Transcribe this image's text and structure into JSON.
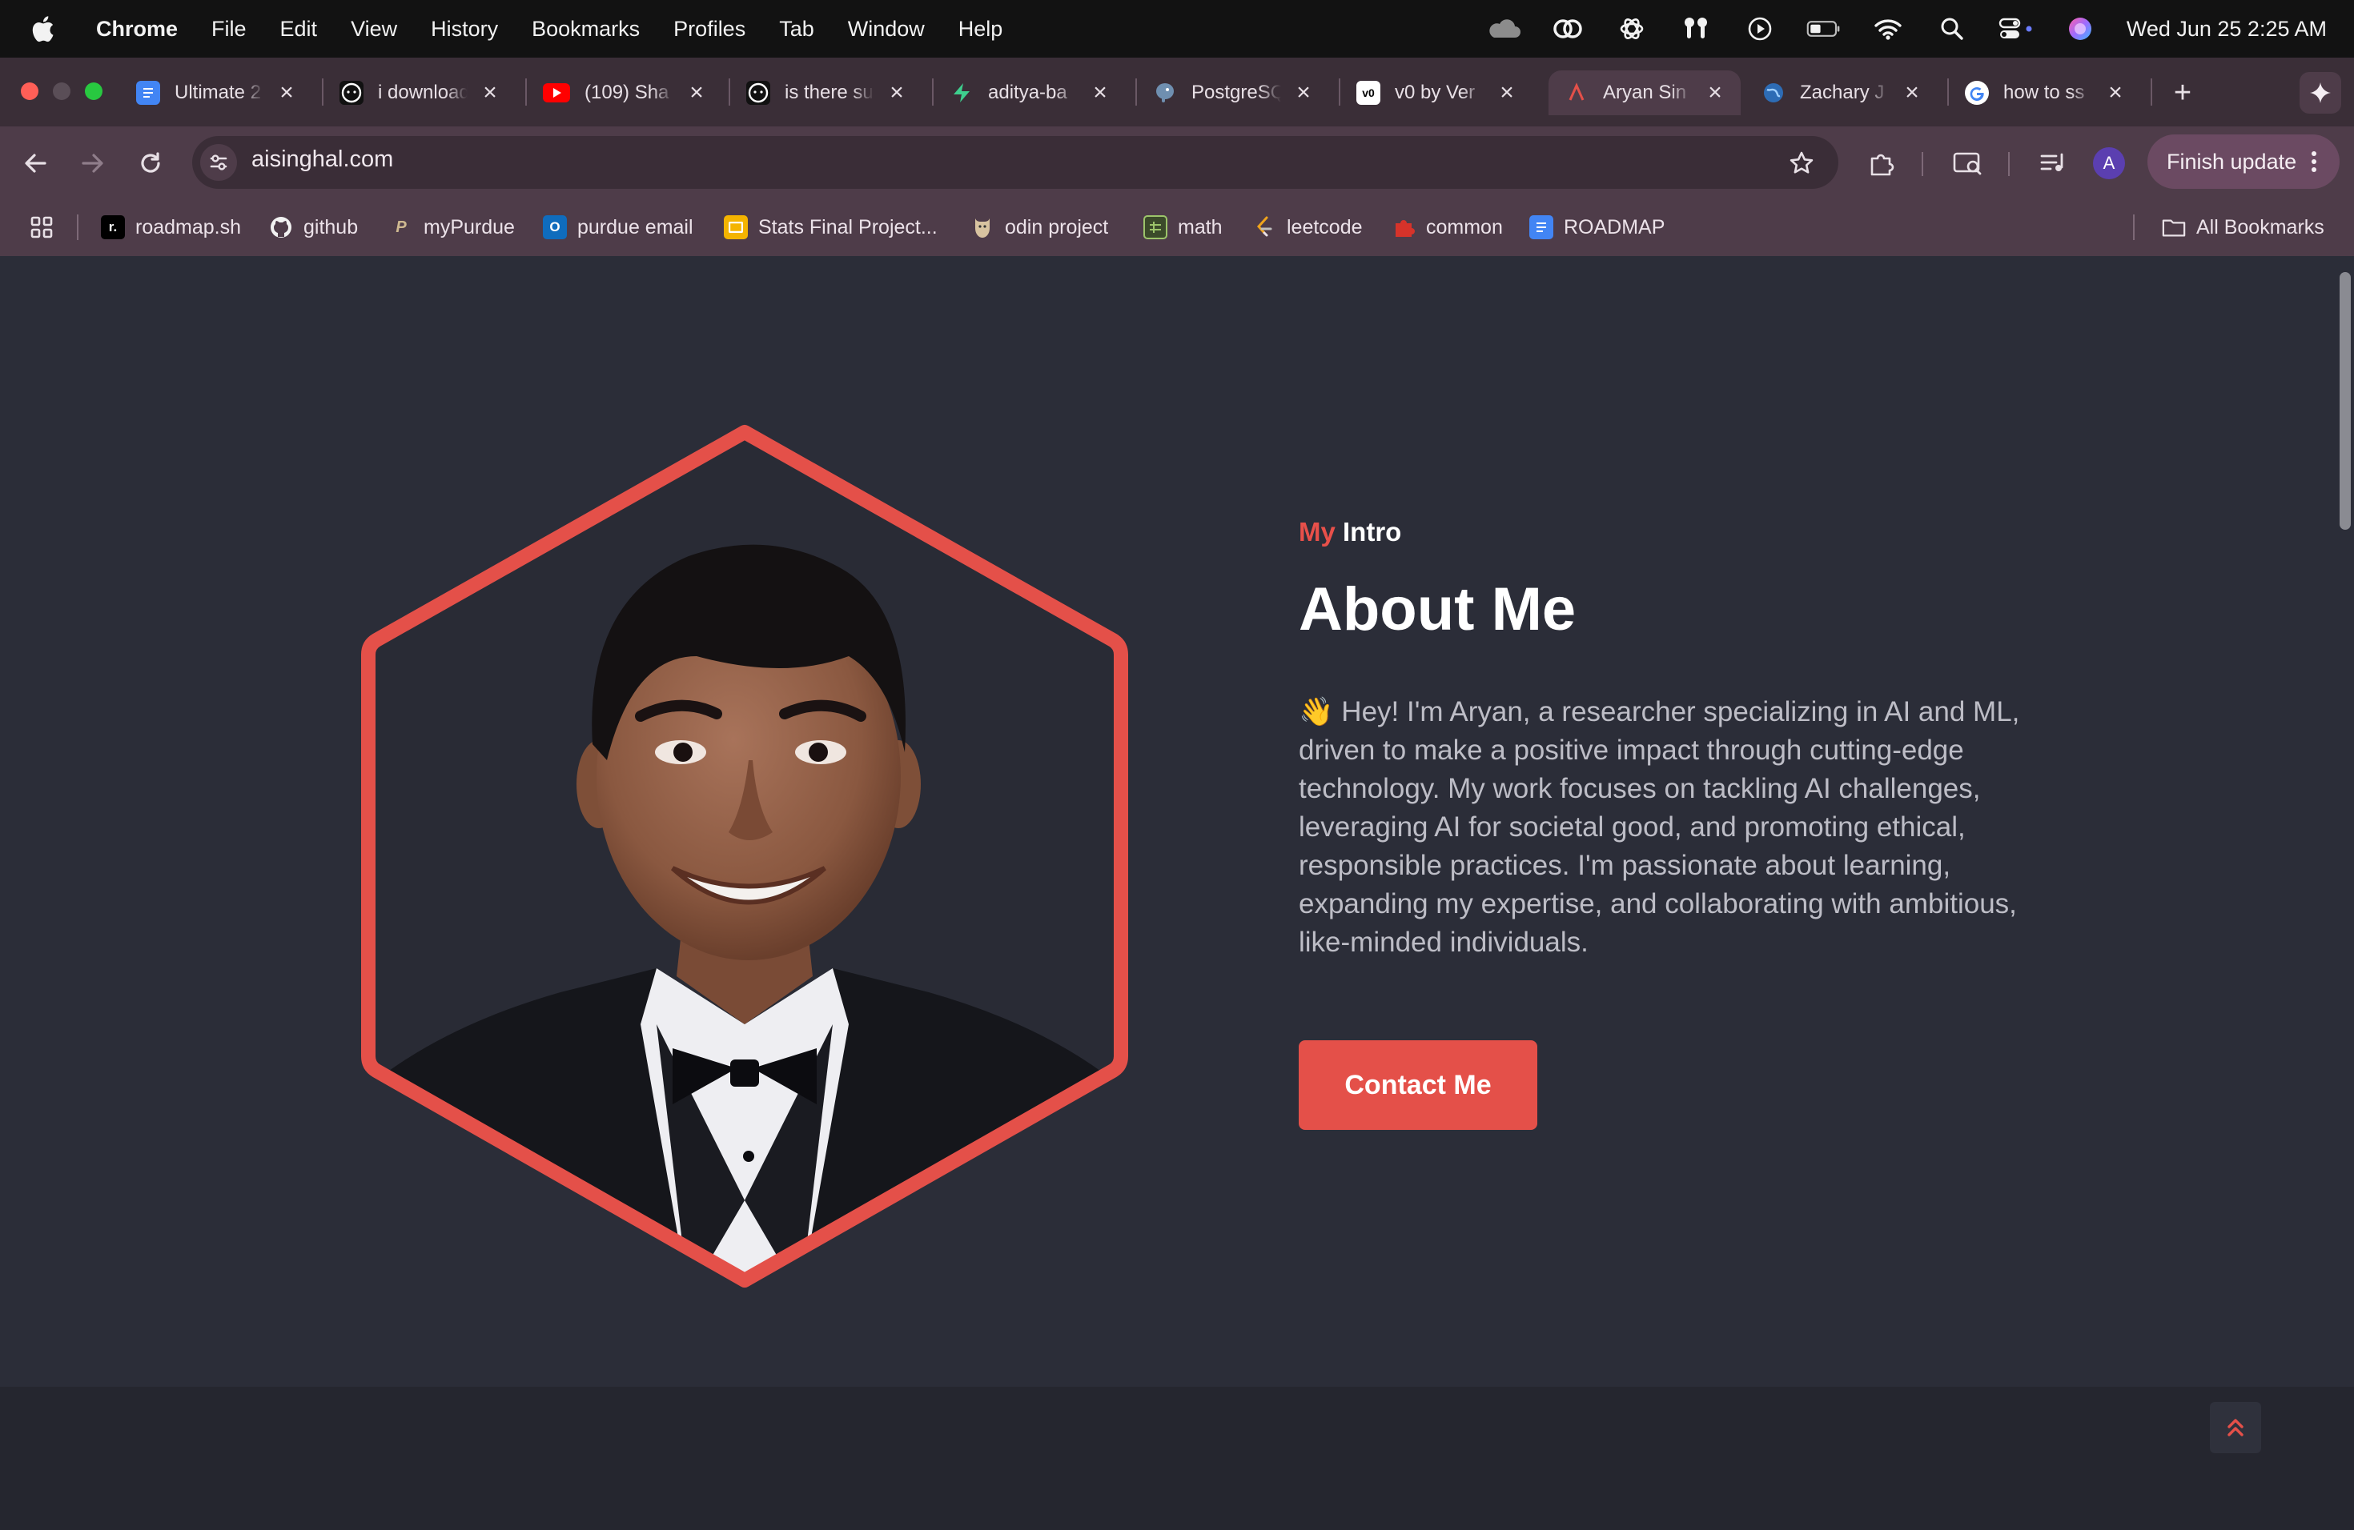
{
  "menubar": {
    "app_name": "Chrome",
    "items": [
      "File",
      "Edit",
      "View",
      "History",
      "Bookmarks",
      "Profiles",
      "Tab",
      "Window",
      "Help"
    ],
    "clock": "Wed Jun 25  2:25 AM"
  },
  "tabs": [
    {
      "title": "Ultimate 2",
      "icon": "google-docs-icon",
      "color": "#4285f4"
    },
    {
      "title": "i download",
      "icon": "github-icon",
      "color": "#ffffff"
    },
    {
      "title": "(109) Sha",
      "icon": "youtube-icon",
      "color": "#ff0000"
    },
    {
      "title": "is there su",
      "icon": "github-icon",
      "color": "#ffffff"
    },
    {
      "title": "aditya-ba",
      "icon": "supabase-icon",
      "color": "#3ecf8e"
    },
    {
      "title": "PostgreSQ",
      "icon": "postgresql-icon",
      "color": "#6f8fb0"
    },
    {
      "title": "v0 by Ver",
      "icon": "v0-icon",
      "color": "#ffffff"
    },
    {
      "title": "Aryan Sin",
      "icon": "portfolio-icon",
      "color": "#e45049",
      "active": true
    },
    {
      "title": "Zachary J",
      "icon": "globe-icon",
      "color": "#4a90d9"
    },
    {
      "title": "how to ss",
      "icon": "google-icon",
      "color": "#ffffff"
    }
  ],
  "toolbar": {
    "url": "aisinghal.com",
    "finish_update": "Finish update",
    "profile_initial": "A"
  },
  "bookmarks": [
    {
      "label": "roadmap.sh",
      "icon": "roadmap-icon"
    },
    {
      "label": "github",
      "icon": "github-icon"
    },
    {
      "label": "myPurdue",
      "icon": "purdue-icon"
    },
    {
      "label": "purdue email",
      "icon": "outlook-icon"
    },
    {
      "label": "Stats Final Project...",
      "icon": "google-slides-icon"
    },
    {
      "label": "odin project",
      "icon": "odin-icon"
    },
    {
      "label": "math",
      "icon": "sheets-icon"
    },
    {
      "label": "leetcode",
      "icon": "leetcode-icon"
    },
    {
      "label": "common",
      "icon": "puzzle-icon"
    },
    {
      "label": "ROADMAP",
      "icon": "google-docs-icon"
    }
  ],
  "all_bookmarks": "All Bookmarks",
  "about": {
    "intro_my": "My",
    "intro_rest": "Intro",
    "heading": "About Me",
    "bio": "👋 Hey! I'm Aryan, a researcher specializing in AI and ML, driven to make a positive impact through cutting-edge technology. My work focuses on tackling AI challenges, leveraging AI for societal good, and promoting ethical, responsible practices. I'm passionate about learning, expanding my expertise, and collaborating with ambitious, like-minded individuals.",
    "contact_button": "Contact Me"
  },
  "colors": {
    "accent": "#e45049",
    "page_bg": "#2b2d38",
    "tab_bar": "#3a2e37",
    "toolbar": "#4e3c49"
  }
}
